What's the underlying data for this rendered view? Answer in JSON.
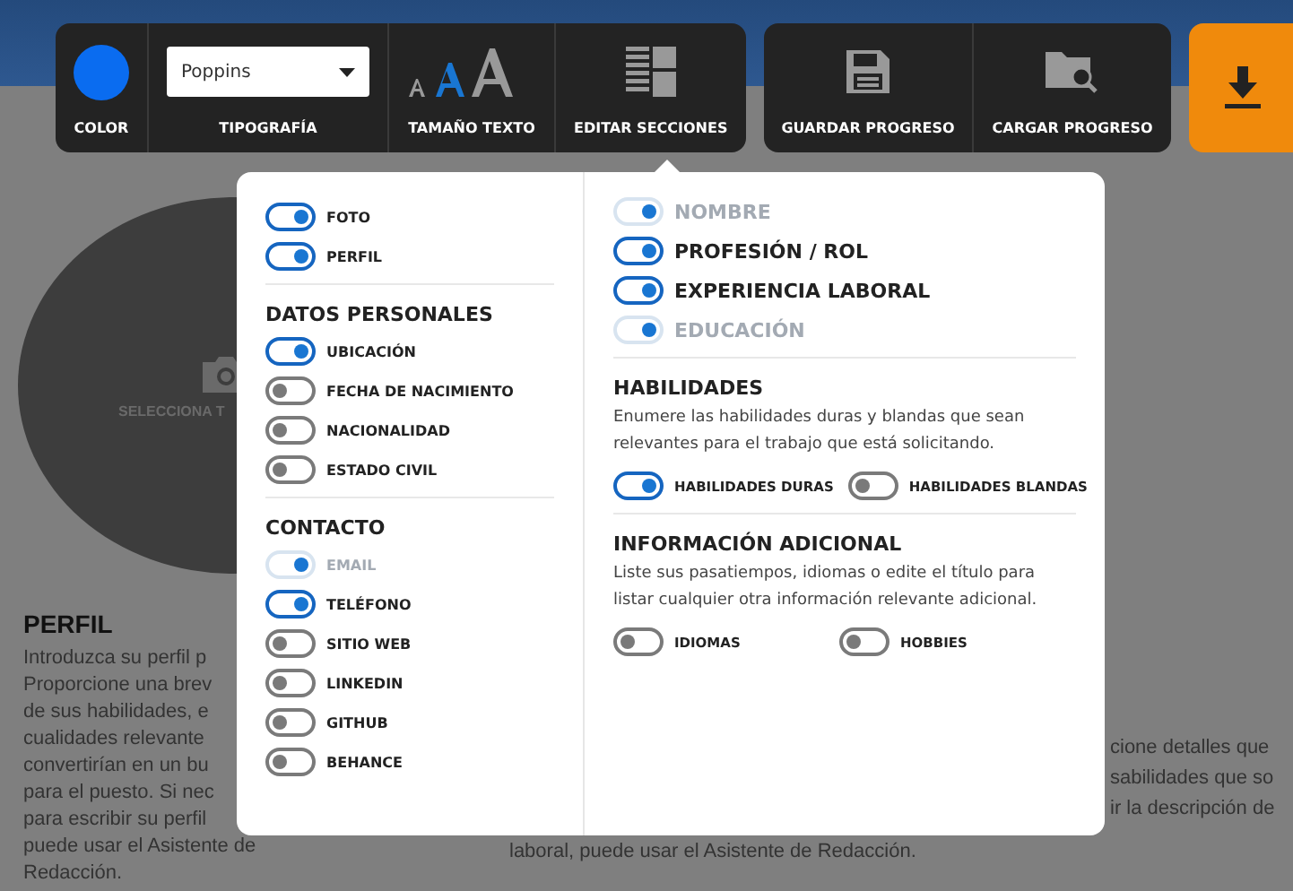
{
  "toolbar": {
    "groups": [
      {
        "tools": [
          {
            "kind": "color",
            "label": "COLOR",
            "color": "#0a6cf0"
          },
          {
            "kind": "font",
            "label": "TIPOGRAFÍA",
            "value": "Poppins"
          },
          {
            "kind": "size",
            "label": "TAMAÑO TEXTO"
          },
          {
            "kind": "sections",
            "label": "EDITAR SECCIONES"
          }
        ]
      },
      {
        "tools": [
          {
            "kind": "save",
            "label": "GUARDAR PROGRESO"
          },
          {
            "kind": "load",
            "label": "CARGAR PROGRESO"
          }
        ]
      }
    ]
  },
  "photo": {
    "label": "SELECCIONA T"
  },
  "profile": {
    "heading": "PERFIL",
    "lines": [
      "Introduzca su perfil p",
      "Proporcione una brev",
      "de sus habilidades, e",
      "cualidades relevante",
      "convertirían en un bu",
      "para el puesto. Si nec",
      "para escribir su perfil",
      "puede usar el Asistente de",
      "Redacción."
    ]
  },
  "experience_fragments": [
    "cione detalles que",
    "sabilidades que so",
    "ir la descripción de"
  ],
  "experience_last_line": "laboral, puede usar el Asistente de Redacción.",
  "sections_popup": {
    "columns": [
      {
        "groups": [
          {
            "items": [
              {
                "label": "FOTO",
                "on": true,
                "disabled": false
              },
              {
                "label": "PERFIL",
                "on": true,
                "disabled": false
              }
            ]
          },
          {
            "heading": "DATOS PERSONALES",
            "items": [
              {
                "label": "UBICACIÓN",
                "on": true,
                "disabled": false
              },
              {
                "label": "FECHA DE NACIMIENTO",
                "on": false,
                "disabled": false
              },
              {
                "label": "NACIONALIDAD",
                "on": false,
                "disabled": false
              },
              {
                "label": "ESTADO CIVIL",
                "on": false,
                "disabled": false
              }
            ]
          },
          {
            "heading": "CONTACTO",
            "items": [
              {
                "label": "EMAIL",
                "on": true,
                "disabled": true
              },
              {
                "label": "TELÉFONO",
                "on": true,
                "disabled": false
              },
              {
                "label": "SITIO WEB",
                "on": false,
                "disabled": false
              },
              {
                "label": "LINKEDIN",
                "on": false,
                "disabled": false
              },
              {
                "label": "GITHUB",
                "on": false,
                "disabled": false
              },
              {
                "label": "BEHANCE",
                "on": false,
                "disabled": false
              }
            ]
          }
        ]
      },
      {
        "groups": [
          {
            "large": true,
            "items": [
              {
                "label": "NOMBRE",
                "on": true,
                "disabled": true
              },
              {
                "label": "PROFESIÓN / ROL",
                "on": true,
                "disabled": false
              },
              {
                "label": "EXPERIENCIA LABORAL",
                "on": true,
                "disabled": false
              },
              {
                "label": "EDUCACIÓN",
                "on": true,
                "disabled": true
              }
            ]
          },
          {
            "heading": "HABILIDADES",
            "description": "Enumere las habilidades duras y blandas que sean relevantes para el trabajo que está solicitando.",
            "inline": true,
            "items": [
              {
                "label": "HABILIDADES DURAS",
                "on": true,
                "disabled": false
              },
              {
                "label": "HABILIDADES BLANDAS",
                "on": false,
                "disabled": false
              }
            ]
          },
          {
            "heading": "INFORMACIÓN ADICIONAL",
            "description": "Liste sus pasatiempos, idiomas o edite el título para listar cualquier otra información relevante adicional.",
            "inline": true,
            "items": [
              {
                "label": "IDIOMAS",
                "on": false,
                "disabled": false
              },
              {
                "label": "HOBBIES",
                "on": false,
                "disabled": false
              }
            ]
          }
        ]
      }
    ]
  }
}
